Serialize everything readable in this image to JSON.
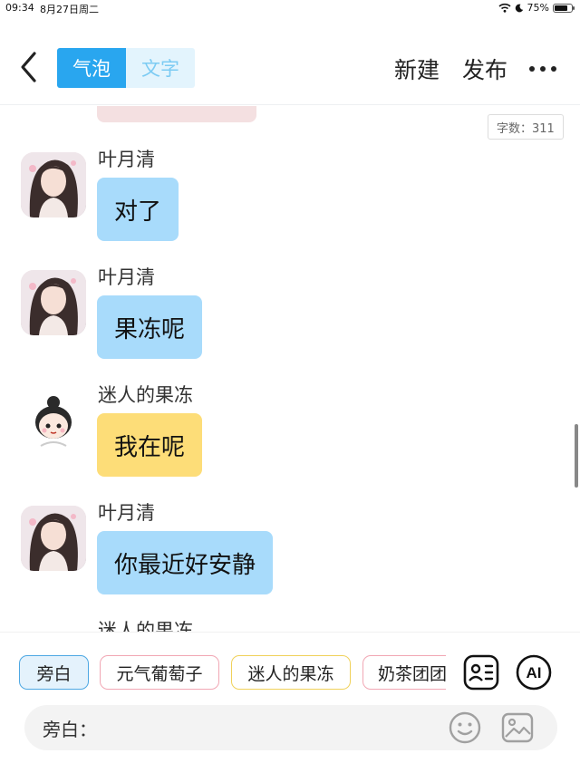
{
  "status_bar": {
    "time": "09:34",
    "date": "8月27日周二",
    "battery": "75%"
  },
  "toolbar": {
    "mode_tabs": [
      "气泡",
      "文字"
    ],
    "new_label": "新建",
    "publish_label": "发布"
  },
  "word_count": "字数：311",
  "messages": [
    {
      "name": "叶月清",
      "text": "对了",
      "avatar": "girl-avatar",
      "bubble_color": "#a8dbfb"
    },
    {
      "name": "叶月清",
      "text": "果冻呢",
      "avatar": "girl-avatar",
      "bubble_color": "#a8dbfb"
    },
    {
      "name": "迷人的果冻",
      "text": "我在呢",
      "avatar": "chibi-avatar",
      "bubble_color": "#fddd78"
    },
    {
      "name": "叶月清",
      "text": "你最近好安静",
      "avatar": "girl-avatar",
      "bubble_color": "#a8dbfb"
    },
    {
      "name": "迷人的果冻",
      "avatar": "chibi-avatar"
    }
  ],
  "roles": [
    "旁白",
    "元气葡萄子",
    "迷人的果冻",
    "奶茶团团"
  ],
  "input": {
    "label": "旁白：",
    "placeholder": ""
  },
  "colors": {
    "accent": "#29a6ef",
    "blue_bubble": "#a8dbfb",
    "yellow_bubble": "#fddd78"
  }
}
